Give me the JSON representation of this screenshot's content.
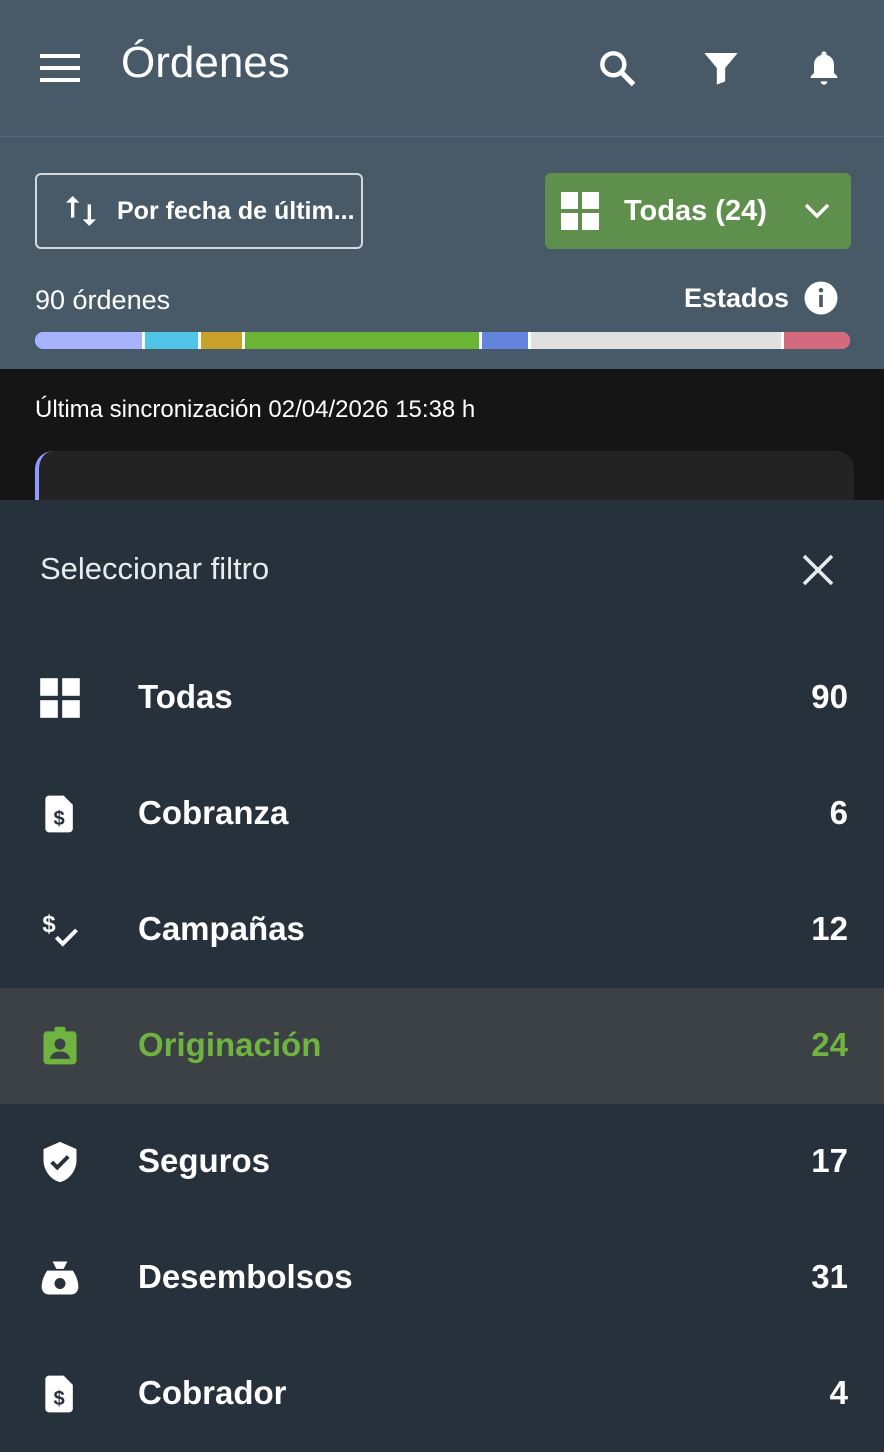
{
  "appbar": {
    "title": "Órdenes",
    "icons": [
      "menu-icon",
      "search-icon",
      "filter-icon",
      "bell-icon"
    ]
  },
  "toolbar": {
    "sort_label": "Por fecha de últim...",
    "filter_label": "Todas (24)",
    "count_label": "90 órdenes",
    "estados_label": "Estados"
  },
  "status_segments": [
    {
      "color": "#a8b3ff",
      "weight": 13
    },
    {
      "color": "#4fc4e6",
      "weight": 6.5
    },
    {
      "color": "#c8a12a",
      "weight": 5
    },
    {
      "color": "#6bb534",
      "weight": 28.5
    },
    {
      "color": "#6384dc",
      "weight": 5.5
    },
    {
      "color": "#e0e0e0",
      "weight": 30.5
    },
    {
      "color": "#d46a7e",
      "weight": 8
    }
  ],
  "sync_text": "Última sincronización 02/04/2026 15:38 h",
  "sheet": {
    "title": "Seleccionar filtro",
    "items": [
      {
        "label": "Todas",
        "count": "90",
        "icon": "grid-icon",
        "selected": false
      },
      {
        "label": "Cobranza",
        "count": "6",
        "icon": "invoice-dollar-icon",
        "selected": false
      },
      {
        "label": "Campañas",
        "count": "12",
        "icon": "dollar-check-icon",
        "selected": false
      },
      {
        "label": "Originación",
        "count": "24",
        "icon": "badge-person-icon",
        "selected": true
      },
      {
        "label": "Seguros",
        "count": "17",
        "icon": "shield-check-icon",
        "selected": false
      },
      {
        "label": "Desembolsos",
        "count": "31",
        "icon": "money-bag-icon",
        "selected": false
      },
      {
        "label": "Cobrador",
        "count": "4",
        "icon": "invoice-dollar-icon",
        "selected": false
      }
    ]
  },
  "colors": {
    "accent_green": "#6fb43f",
    "filter_button": "#5f8f4c",
    "header_bg": "#485a67",
    "sheet_bg": "#26313c"
  }
}
